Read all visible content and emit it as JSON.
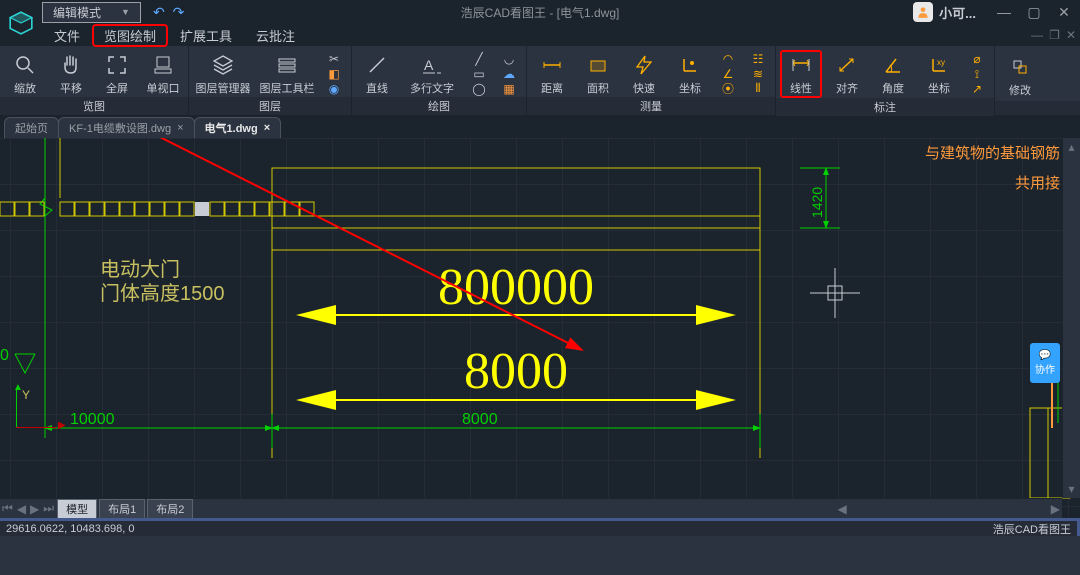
{
  "titlebar": {
    "edit_mode": "编辑模式",
    "app_title": "浩辰CAD看图王 - [电气1.dwg]",
    "user": "小可..."
  },
  "menu": {
    "file": "文件",
    "view_draw": "览图绘制",
    "ext_tools": "扩展工具",
    "cloud_note": "云批注"
  },
  "ribbon": {
    "groups": {
      "view": "览图",
      "layer": "图层",
      "draw": "绘图",
      "measure": "测量",
      "dim": "标注"
    },
    "tools": {
      "zoom": "缩放",
      "pan": "平移",
      "fullscreen": "全屏",
      "viewport": "单视口",
      "layermgr": "图层管理器",
      "layerbar": "图层工具栏",
      "line": "直线",
      "mtext": "多行文字",
      "dist": "距离",
      "area": "面积",
      "quick": "快速",
      "coords1": "坐标",
      "linear": "线性",
      "align": "对齐",
      "angle": "角度",
      "coords2": "坐标",
      "modify": "修改"
    }
  },
  "doctabs": {
    "start": "起始页",
    "t1": "KF-1电缆敷设图.dwg",
    "t2": "电气1.dwg"
  },
  "canvas": {
    "text1": "电动大门",
    "text2": "门体高度1500",
    "dim0": "0",
    "dimA": "800000",
    "dimB": "8000",
    "dim10000": "10000",
    "dim8000": "8000",
    "dim1420": "1420",
    "note1": "与建筑物的基础钢筋",
    "note2": "共用接",
    "axis_y": "Y",
    "xiezuo": "协作"
  },
  "sheets": {
    "model": "模型",
    "layout1": "布局1",
    "layout2": "布局2"
  },
  "status": {
    "coords": "29616.0622, 10483.698, 0",
    "app": "浩辰CAD看图王"
  }
}
